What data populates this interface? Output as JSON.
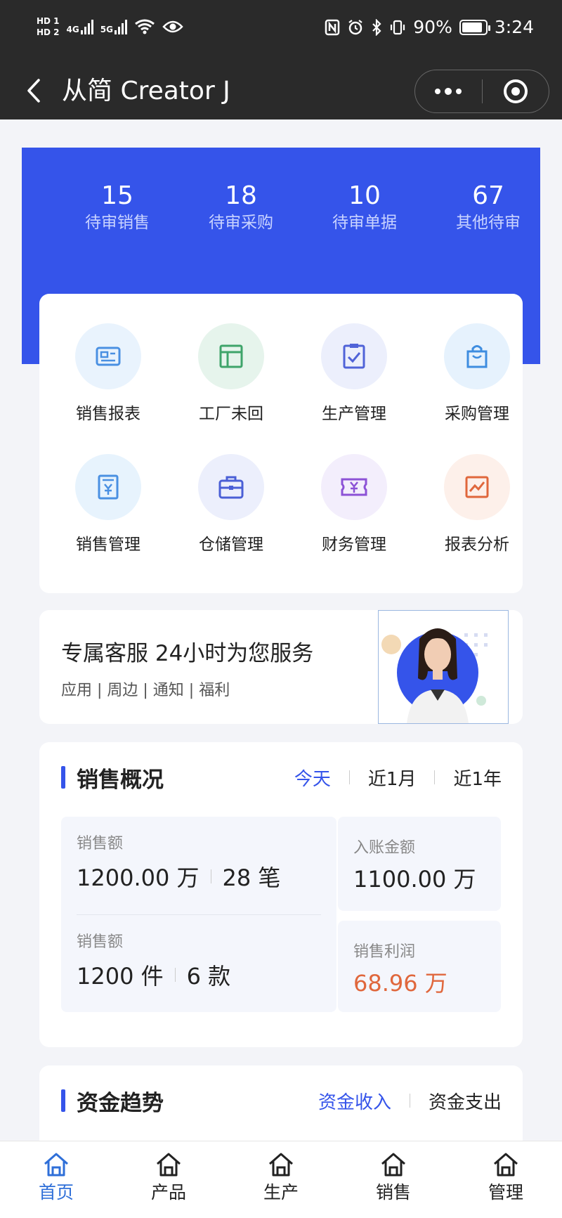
{
  "status_bar": {
    "hd1": "HD 1",
    "hd2": "HD 2",
    "net1": "4G",
    "net2": "5G",
    "battery_pct": "90%",
    "time": "3:24"
  },
  "nav": {
    "title": "从简 Creator J"
  },
  "pending": [
    {
      "count": "15",
      "label": "待审销售"
    },
    {
      "count": "18",
      "label": "待审采购"
    },
    {
      "count": "10",
      "label": "待审单据"
    },
    {
      "count": "67",
      "label": "其他待审"
    }
  ],
  "grid": [
    {
      "label": "销售报表",
      "icon": "report-card-icon",
      "bg": "#e9f3fd",
      "color": "#4a90e2"
    },
    {
      "label": "工厂未回",
      "icon": "layout-icon",
      "bg": "#e6f4ec",
      "color": "#3fa46a"
    },
    {
      "label": "生产管理",
      "icon": "clipboard-check-icon",
      "bg": "#eceffc",
      "color": "#5063d8"
    },
    {
      "label": "采购管理",
      "icon": "shopping-bag-icon",
      "bg": "#e6f2fd",
      "color": "#3e8de0"
    },
    {
      "label": "销售管理",
      "icon": "yen-document-icon",
      "bg": "#e7f3fd",
      "color": "#4a90e2"
    },
    {
      "label": "仓储管理",
      "icon": "briefcase-icon",
      "bg": "#eceffc",
      "color": "#4a5fd6"
    },
    {
      "label": "财务管理",
      "icon": "yen-ticket-icon",
      "bg": "#f3eefc",
      "color": "#8c52d6"
    },
    {
      "label": "报表分析",
      "icon": "chart-line-icon",
      "bg": "#fdf0ea",
      "color": "#e0673c"
    }
  ],
  "service": {
    "title": "专属客服 24小时为您服务",
    "subtitle": "应用 | 周边 | 通知 | 福利"
  },
  "sales": {
    "title": "销售概况",
    "tabs": [
      "今天",
      "近1月",
      "近1年"
    ],
    "active_tab": 0,
    "metric1": {
      "label": "销售额",
      "value_a": "1200.00 万",
      "value_b": "28 笔"
    },
    "metric2": {
      "label": "销售额",
      "value_a": "1200 件",
      "value_b": "6 款"
    },
    "metric3": {
      "label": "入账金额",
      "value": "1100.00 万"
    },
    "metric4": {
      "label": "销售利润",
      "value": "68.96 万"
    }
  },
  "funds": {
    "title": "资金趋势",
    "tabs": [
      "资金收入",
      "资金支出"
    ]
  },
  "tabbar": [
    {
      "label": "首页",
      "active": true
    },
    {
      "label": "产品",
      "active": false
    },
    {
      "label": "生产",
      "active": false
    },
    {
      "label": "销售",
      "active": false
    },
    {
      "label": "管理",
      "active": false
    }
  ],
  "colors": {
    "brand_blue": "#3554ea",
    "accent_orange": "#e0673c",
    "tab_active": "#2f6fd8"
  }
}
